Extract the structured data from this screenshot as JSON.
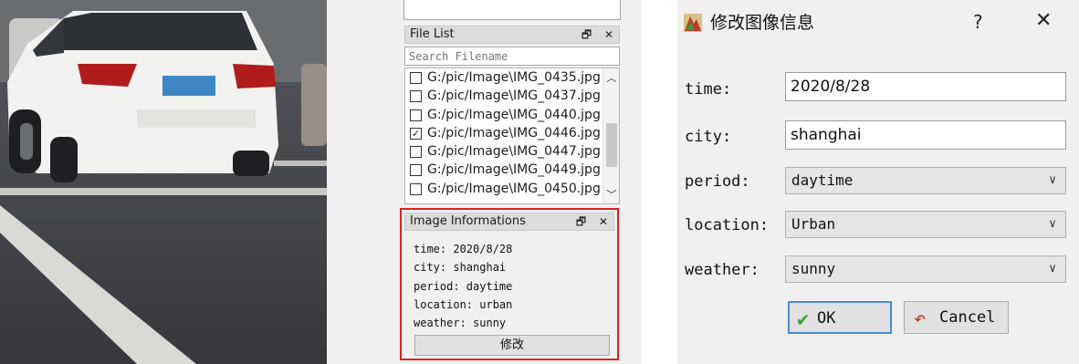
{
  "file_list": {
    "title": "File List",
    "search_placeholder": "Search Filename",
    "files": [
      {
        "name": "G:/pic/Image\\IMG_0435.jpg",
        "checked": false
      },
      {
        "name": "G:/pic/Image\\IMG_0437.jpg",
        "checked": false
      },
      {
        "name": "G:/pic/Image\\IMG_0440.jpg",
        "checked": false
      },
      {
        "name": "G:/pic/Image\\IMG_0446.jpg",
        "checked": true
      },
      {
        "name": "G:/pic/Image\\IMG_0447.jpg",
        "checked": false
      },
      {
        "name": "G:/pic/Image\\IMG_0449.jpg",
        "checked": false
      },
      {
        "name": "G:/pic/Image\\IMG_0450.jpg",
        "checked": false
      }
    ]
  },
  "image_info": {
    "title": "Image Informations",
    "lines": [
      "time: 2020/8/28",
      "city: shanghai",
      "period: daytime",
      "location: urban",
      "weather: sunny"
    ],
    "modify_label": "修改"
  },
  "dock_buttons": {
    "float": "🗗",
    "close": "✕"
  },
  "dialog": {
    "title": "修改图像信息",
    "help": "?",
    "close": "✕",
    "fields": {
      "time": {
        "label": "time:",
        "value": "2020/8/28"
      },
      "city": {
        "label": "city:",
        "value": "shanghai"
      },
      "period": {
        "label": "period:",
        "value": "daytime"
      },
      "location": {
        "label": "location:",
        "value": "Urban"
      },
      "weather": {
        "label": "weather:",
        "value": "sunny"
      }
    },
    "ok_label": "OK",
    "cancel_label": "Cancel"
  },
  "colors": {
    "highlight_border": "#e02020",
    "ok_focus_border": "#4a8bd8",
    "car_body": "#f2f2f0",
    "plate": "#3f86c4"
  },
  "icons": {
    "dock_float": "float-window-icon",
    "dock_close": "close-icon",
    "ok": "checkmark-icon",
    "cancel": "undo-arrow-icon",
    "dialog": "app-image-icon",
    "dropdown": "chevron-down-icon"
  }
}
